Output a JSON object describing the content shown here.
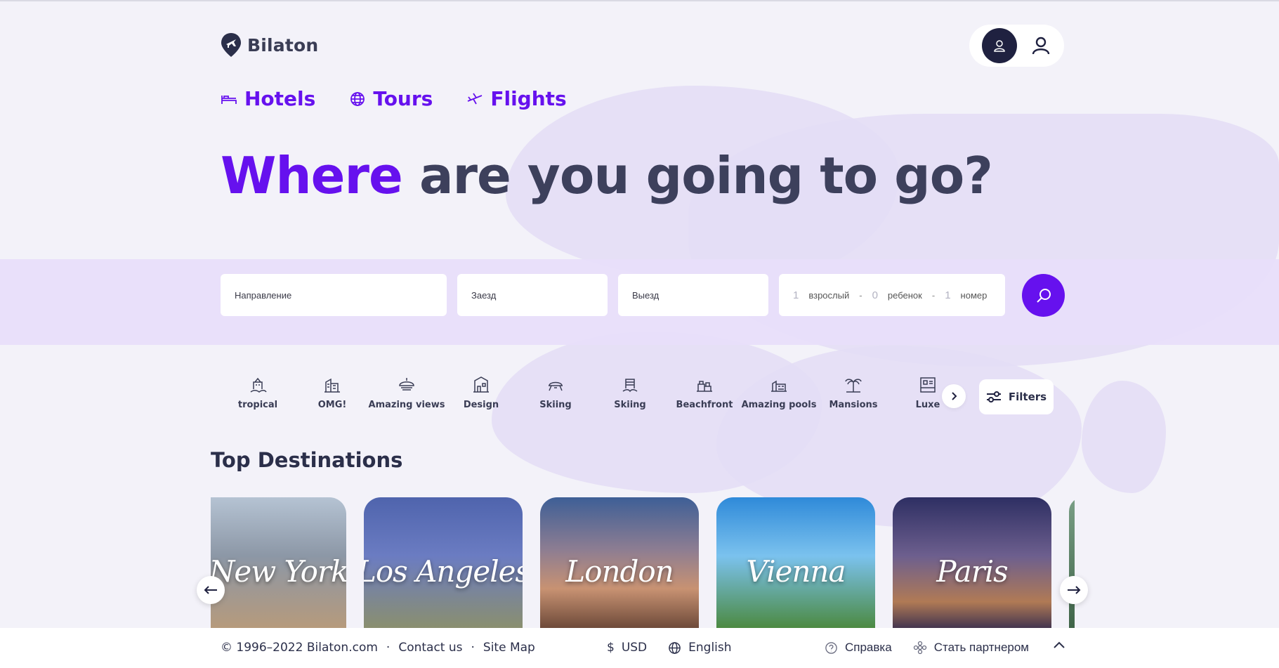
{
  "brand": {
    "name": "Bilaton"
  },
  "tabs": [
    {
      "label": "Hotels",
      "icon": "bed-icon"
    },
    {
      "label": "Tours",
      "icon": "globe-icon"
    },
    {
      "label": "Flights",
      "icon": "plane-icon"
    }
  ],
  "hero": {
    "accent": "Where",
    "rest": "are you going to go?"
  },
  "search": {
    "destination_placeholder": "Направление",
    "checkin_placeholder": "Заезд",
    "checkout_placeholder": "Выезд",
    "guests": {
      "adults": "1",
      "adults_label": "взрослый",
      "children": "0",
      "children_label": "ребенок",
      "rooms": "1",
      "rooms_label": "номер"
    }
  },
  "categories": [
    {
      "label": "tropical",
      "icon": "tropical-icon"
    },
    {
      "label": "OMG!",
      "icon": "omg-icon"
    },
    {
      "label": "Amazing views",
      "icon": "views-icon"
    },
    {
      "label": "Design",
      "icon": "design-icon"
    },
    {
      "label": "Skiing",
      "icon": "skiing-icon"
    },
    {
      "label": "Skiing",
      "icon": "skiing-alt-icon"
    },
    {
      "label": "Beachfront",
      "icon": "beachfront-icon"
    },
    {
      "label": "Amazing pools",
      "icon": "pools-icon"
    },
    {
      "label": "Mansions",
      "icon": "mansions-icon"
    },
    {
      "label": "Luxe",
      "icon": "luxe-icon"
    }
  ],
  "filters_label": "Filters",
  "top_destinations": {
    "title": "Top Destinations",
    "items": [
      "New York",
      "Los Angeles",
      "London",
      "Vienna",
      "Paris"
    ]
  },
  "footer": {
    "copyright": "© 1996–2022 Bilaton.com",
    "contact": "Contact us",
    "sitemap": "Site Map",
    "currency_symbol": "$",
    "currency": "USD",
    "language": "English",
    "help": "Справка",
    "partner": "Стать партнером"
  },
  "colors": {
    "accent": "#6611ee",
    "dark": "#1f2140",
    "band": "#e8defa"
  }
}
